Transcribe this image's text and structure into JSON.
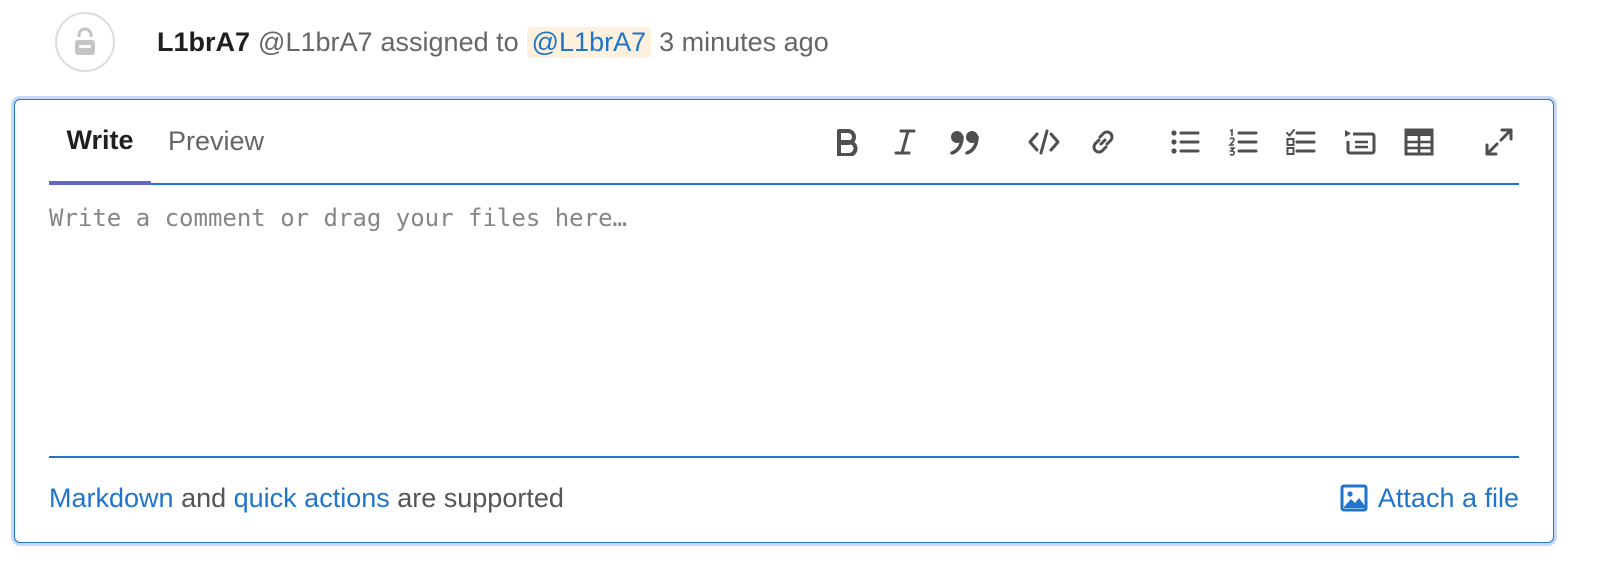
{
  "activity": {
    "author_name": "L1brA7",
    "author_handle": "@L1brA7",
    "action": "assigned to",
    "assignee_mention": "@L1brA7",
    "time_ago": "3 minutes ago"
  },
  "editor": {
    "tabs": [
      {
        "label": "Write",
        "active": true
      },
      {
        "label": "Preview",
        "active": false
      }
    ],
    "toolbar": [
      {
        "icon": "bold-icon",
        "title": "Add bold text"
      },
      {
        "icon": "italic-icon",
        "title": "Add italic text"
      },
      {
        "icon": "quote-icon",
        "title": "Insert a quote"
      },
      {
        "icon": "code-icon",
        "title": "Insert code"
      },
      {
        "icon": "link-icon",
        "title": "Add a link"
      },
      {
        "icon": "bullet-list-icon",
        "title": "Add a bullet list"
      },
      {
        "icon": "numbered-list-icon",
        "title": "Add a numbered list"
      },
      {
        "icon": "task-list-icon",
        "title": "Add a checklist"
      },
      {
        "icon": "collapsible-section-icon",
        "title": "Add a collapsible section"
      },
      {
        "icon": "table-icon",
        "title": "Add a table"
      },
      {
        "icon": "fullscreen-icon",
        "title": "Go full screen"
      }
    ],
    "placeholder": "Write a comment or drag your files here…",
    "footer": {
      "markdown_link": "Markdown",
      "and_text": "and",
      "quick_actions_link": "quick actions",
      "supported_text": "are supported",
      "attach_label": "Attach a file"
    }
  },
  "colors": {
    "accent": "#1f75cb",
    "active_tab_underline": "#6666c4",
    "mention_bg": "#fdf1dd",
    "icon": "#4f4f4f"
  }
}
